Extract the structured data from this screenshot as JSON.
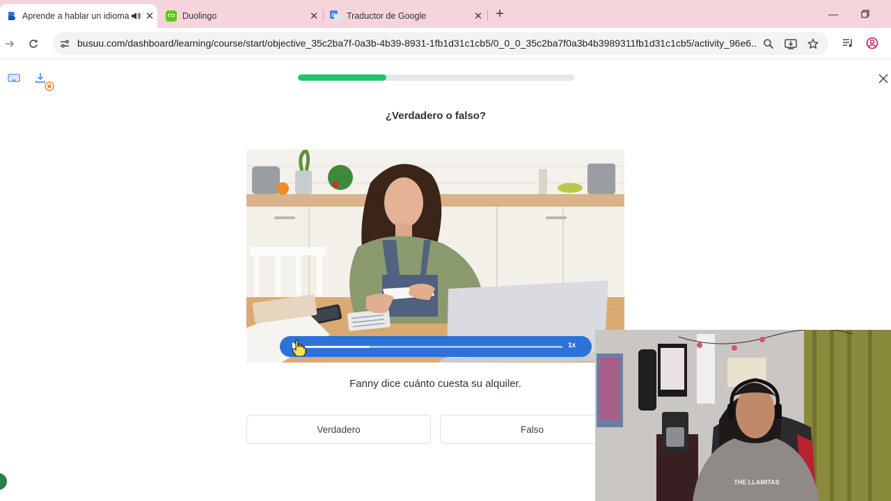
{
  "browser": {
    "tabs": [
      {
        "title": "Aprende a hablar un idioma",
        "active": true,
        "icon": "busuu-icon"
      },
      {
        "title": "Duolingo",
        "active": false,
        "icon": "duolingo-icon"
      },
      {
        "title": "Traductor de Google",
        "active": false,
        "icon": "google-translate-icon"
      }
    ],
    "url": "busuu.com/dashboard/learning/course/start/objective_35c2ba7f-0a3b-4b39-8931-1fb1d31c1cb5/0_0_0_35c2ba7f0a3b4b3989311fb1d31c1cb5/activity_96e6..."
  },
  "lesson": {
    "progress_percent": 32,
    "question": "¿Verdadero o falso?",
    "audio": {
      "progress_fraction": 0.25,
      "speed_label": "1x"
    },
    "statement": "Fanny dice cuánto cuesta su alquiler.",
    "answers": [
      {
        "label": "Verdadero"
      },
      {
        "label": "Falso"
      }
    ]
  },
  "webcam": {
    "shirt_text": "THE LLAMITAS"
  },
  "colors": {
    "progress_green": "#21c46d",
    "audio_blue": "#2c72d8",
    "tabbar_pink": "#f6d4dc"
  }
}
